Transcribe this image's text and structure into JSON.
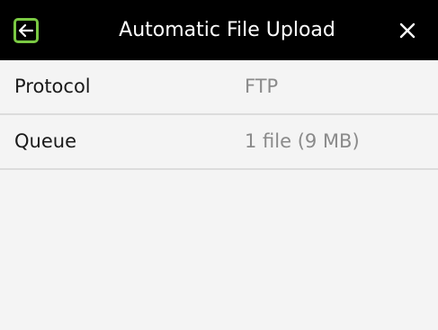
{
  "header": {
    "title": "Automatic File Upload",
    "back_icon": "back-arrow-icon",
    "close_icon": "close-icon",
    "back_outline_color": "#7ac943"
  },
  "settings": [
    {
      "label": "Protocol",
      "value": "FTP"
    },
    {
      "label": "Queue",
      "value": "1 file (9 MB)"
    }
  ]
}
